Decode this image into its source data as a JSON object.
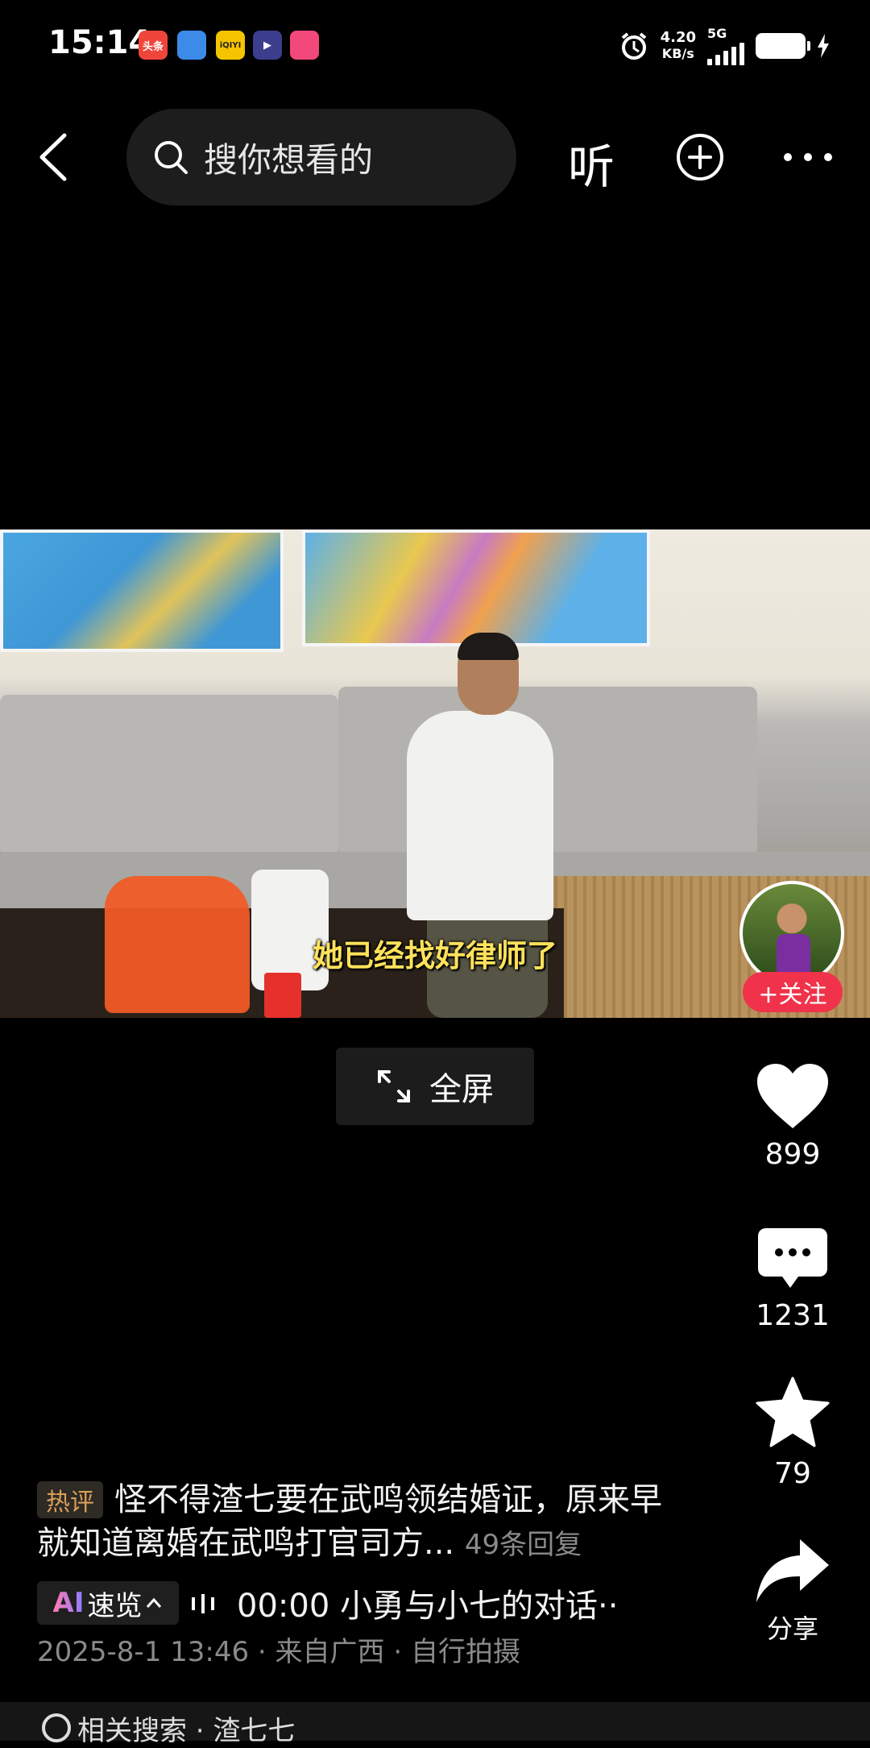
{
  "status_bar": {
    "time": "15:14",
    "apps": [
      {
        "name": "头条",
        "color": "#f0453a"
      },
      {
        "name": "",
        "color": "#3c8be8"
      },
      {
        "name": "iQIYI",
        "color": "#f5c400"
      },
      {
        "name": "",
        "color": "#3a3e8c"
      },
      {
        "name": "",
        "color": "#f2487a"
      }
    ],
    "net_speed": "4.20",
    "net_unit": "KB/s",
    "net_type": "5G"
  },
  "top_nav": {
    "search_placeholder": "搜你想看的",
    "listen_label": "听"
  },
  "video": {
    "subtitle": "她已经找好律师了",
    "follow_label": "+关注",
    "fullscreen_label": "全屏"
  },
  "actions": {
    "like_count": "899",
    "comment_count": "1231",
    "favorite_count": "79",
    "share_label": "分享"
  },
  "info": {
    "hot_tag": "热评",
    "hot_comment": "怪不得渣七要在武鸣领结婚证，原来早就知道离婚在武鸣打官司方...",
    "replies": "49条回复",
    "ai_label_ai": "AI",
    "ai_label_text": "速览",
    "summary": "00:00 小勇与小七的对话··",
    "meta": "2025-8-1 13:46 · 来自广西 · 自行拍摄"
  },
  "bottom_bar": {
    "text": "相关搜索 · 渣七七"
  },
  "colors": {
    "background": "#000000",
    "follow": "#f0334a",
    "subtitle": "#ffe25a",
    "hot_tag": "#d9a05a"
  }
}
